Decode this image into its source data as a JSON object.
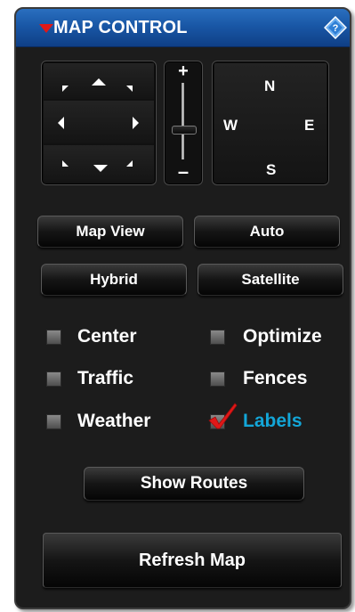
{
  "panel": {
    "title": "MAP CONTROL",
    "title_triangle": "collapse-triangle",
    "help_icon": "diamond-help-icon",
    "colors": {
      "title_bar": "#1957a6",
      "triangle": "#e01818",
      "checked_label": "#13a6d8",
      "checkmark": "#e01818"
    }
  },
  "pan_control": {
    "arrows": [
      "up",
      "up-left",
      "up-right",
      "left",
      "right",
      "down",
      "down-left",
      "down-right"
    ]
  },
  "zoom_control": {
    "plus": "+",
    "minus": "–"
  },
  "compass": {
    "north": "N",
    "west": "W",
    "east": "E",
    "south": "S"
  },
  "buttons": {
    "map_view": "Map View",
    "auto": "Auto",
    "hybrid": "Hybrid",
    "satellite": "Satellite",
    "show_routes": "Show Routes",
    "refresh_map": "Refresh Map"
  },
  "options": [
    {
      "label": "Center",
      "checked": false
    },
    {
      "label": "Optimize",
      "checked": false
    },
    {
      "label": "Traffic",
      "checked": false
    },
    {
      "label": "Fences",
      "checked": false
    },
    {
      "label": "Weather",
      "checked": false
    },
    {
      "label": "Labels",
      "checked": true
    }
  ]
}
